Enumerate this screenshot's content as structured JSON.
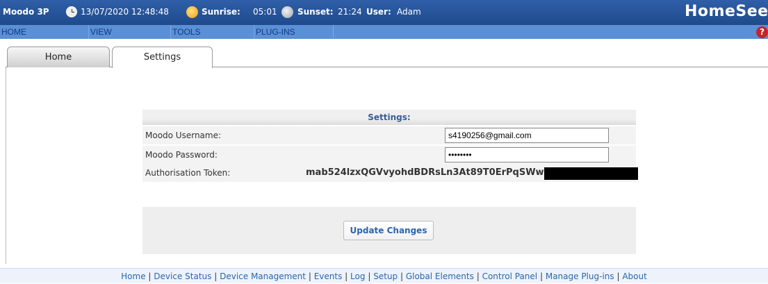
{
  "header": {
    "device": "Moodo 3P",
    "datetime": "13/07/2020 12:48:48",
    "sunrise_label": "Sunrise:",
    "sunrise_time": "05:01",
    "sunset_label": "Sunset:",
    "sunset_time": "21:24",
    "user_label": "User:",
    "user_name": "Adam",
    "logo_text": "HomeSeer"
  },
  "menu": [
    "HOME",
    "VIEW",
    "TOOLS",
    "PLUG-INS"
  ],
  "tabs": [
    {
      "label": "Home",
      "active": false
    },
    {
      "label": "Settings",
      "active": true
    }
  ],
  "settings": {
    "title": "Settings:",
    "username_label": "Moodo Username:",
    "username_value": "s4190256@gmail.com",
    "password_label": "Moodo Password:",
    "password_value": "••••••••",
    "token_label": "Authorisation Token:",
    "token_value": "mab524lzxQGVvyohdBDRsLn3At89T0ErPqSWw1",
    "update_button": "Update Changes"
  },
  "footer_links": [
    "Home",
    "Device Status",
    "Device Management",
    "Events",
    "Log",
    "Setup",
    "Global Elements",
    "Control Panel",
    "Manage Plug-ins",
    "About"
  ],
  "colors": {
    "topbar": "#1f4a8c",
    "menubar": "#5b8fd6",
    "accent_link": "#2a66aa",
    "help": "#c0262d"
  }
}
